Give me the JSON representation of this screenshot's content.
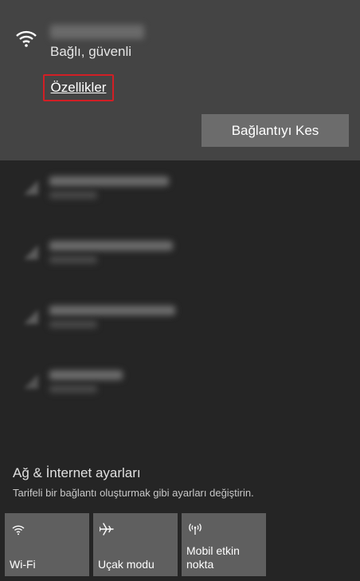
{
  "connected_network": {
    "status": "Bağlı, güvenli",
    "properties_label": "Özellikler",
    "disconnect_label": "Bağlantıyı Kes"
  },
  "settings": {
    "title": "Ağ & İnternet ayarları",
    "description": "Tarifeli bir bağlantı oluşturmak gibi ayarları değiştirin."
  },
  "quick_actions": [
    {
      "label": "Wi-Fi",
      "icon": "wifi-icon"
    },
    {
      "label": "Uçak modu",
      "icon": "airplane-icon"
    },
    {
      "label": "Mobil etkin nokta",
      "icon": "mobile-hotspot-icon"
    }
  ],
  "colors": {
    "connected_panel": "#444444",
    "background": "#252525",
    "highlight_border": "#d21f25",
    "tile": "#5f5f5f"
  }
}
